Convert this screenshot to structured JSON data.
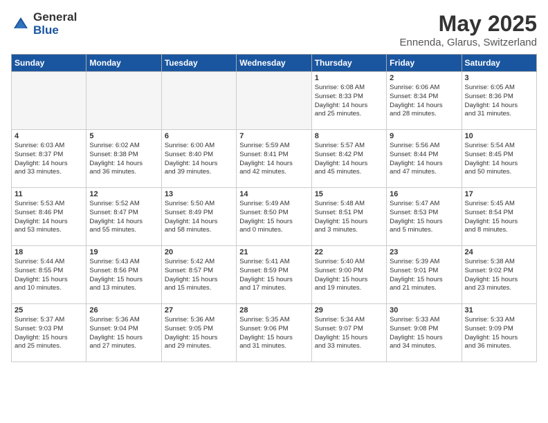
{
  "logo": {
    "general": "General",
    "blue": "Blue"
  },
  "title": "May 2025",
  "subtitle": "Ennenda, Glarus, Switzerland",
  "headers": [
    "Sunday",
    "Monday",
    "Tuesday",
    "Wednesday",
    "Thursday",
    "Friday",
    "Saturday"
  ],
  "weeks": [
    [
      {
        "day": "",
        "content": "",
        "empty": true
      },
      {
        "day": "",
        "content": "",
        "empty": true
      },
      {
        "day": "",
        "content": "",
        "empty": true
      },
      {
        "day": "",
        "content": "",
        "empty": true
      },
      {
        "day": "1",
        "content": "Sunrise: 6:08 AM\nSunset: 8:33 PM\nDaylight: 14 hours\nand 25 minutes."
      },
      {
        "day": "2",
        "content": "Sunrise: 6:06 AM\nSunset: 8:34 PM\nDaylight: 14 hours\nand 28 minutes."
      },
      {
        "day": "3",
        "content": "Sunrise: 6:05 AM\nSunset: 8:36 PM\nDaylight: 14 hours\nand 31 minutes."
      }
    ],
    [
      {
        "day": "4",
        "content": "Sunrise: 6:03 AM\nSunset: 8:37 PM\nDaylight: 14 hours\nand 33 minutes."
      },
      {
        "day": "5",
        "content": "Sunrise: 6:02 AM\nSunset: 8:38 PM\nDaylight: 14 hours\nand 36 minutes."
      },
      {
        "day": "6",
        "content": "Sunrise: 6:00 AM\nSunset: 8:40 PM\nDaylight: 14 hours\nand 39 minutes."
      },
      {
        "day": "7",
        "content": "Sunrise: 5:59 AM\nSunset: 8:41 PM\nDaylight: 14 hours\nand 42 minutes."
      },
      {
        "day": "8",
        "content": "Sunrise: 5:57 AM\nSunset: 8:42 PM\nDaylight: 14 hours\nand 45 minutes."
      },
      {
        "day": "9",
        "content": "Sunrise: 5:56 AM\nSunset: 8:44 PM\nDaylight: 14 hours\nand 47 minutes."
      },
      {
        "day": "10",
        "content": "Sunrise: 5:54 AM\nSunset: 8:45 PM\nDaylight: 14 hours\nand 50 minutes."
      }
    ],
    [
      {
        "day": "11",
        "content": "Sunrise: 5:53 AM\nSunset: 8:46 PM\nDaylight: 14 hours\nand 53 minutes."
      },
      {
        "day": "12",
        "content": "Sunrise: 5:52 AM\nSunset: 8:47 PM\nDaylight: 14 hours\nand 55 minutes."
      },
      {
        "day": "13",
        "content": "Sunrise: 5:50 AM\nSunset: 8:49 PM\nDaylight: 14 hours\nand 58 minutes."
      },
      {
        "day": "14",
        "content": "Sunrise: 5:49 AM\nSunset: 8:50 PM\nDaylight: 15 hours\nand 0 minutes."
      },
      {
        "day": "15",
        "content": "Sunrise: 5:48 AM\nSunset: 8:51 PM\nDaylight: 15 hours\nand 3 minutes."
      },
      {
        "day": "16",
        "content": "Sunrise: 5:47 AM\nSunset: 8:53 PM\nDaylight: 15 hours\nand 5 minutes."
      },
      {
        "day": "17",
        "content": "Sunrise: 5:45 AM\nSunset: 8:54 PM\nDaylight: 15 hours\nand 8 minutes."
      }
    ],
    [
      {
        "day": "18",
        "content": "Sunrise: 5:44 AM\nSunset: 8:55 PM\nDaylight: 15 hours\nand 10 minutes."
      },
      {
        "day": "19",
        "content": "Sunrise: 5:43 AM\nSunset: 8:56 PM\nDaylight: 15 hours\nand 13 minutes."
      },
      {
        "day": "20",
        "content": "Sunrise: 5:42 AM\nSunset: 8:57 PM\nDaylight: 15 hours\nand 15 minutes."
      },
      {
        "day": "21",
        "content": "Sunrise: 5:41 AM\nSunset: 8:59 PM\nDaylight: 15 hours\nand 17 minutes."
      },
      {
        "day": "22",
        "content": "Sunrise: 5:40 AM\nSunset: 9:00 PM\nDaylight: 15 hours\nand 19 minutes."
      },
      {
        "day": "23",
        "content": "Sunrise: 5:39 AM\nSunset: 9:01 PM\nDaylight: 15 hours\nand 21 minutes."
      },
      {
        "day": "24",
        "content": "Sunrise: 5:38 AM\nSunset: 9:02 PM\nDaylight: 15 hours\nand 23 minutes."
      }
    ],
    [
      {
        "day": "25",
        "content": "Sunrise: 5:37 AM\nSunset: 9:03 PM\nDaylight: 15 hours\nand 25 minutes."
      },
      {
        "day": "26",
        "content": "Sunrise: 5:36 AM\nSunset: 9:04 PM\nDaylight: 15 hours\nand 27 minutes."
      },
      {
        "day": "27",
        "content": "Sunrise: 5:36 AM\nSunset: 9:05 PM\nDaylight: 15 hours\nand 29 minutes."
      },
      {
        "day": "28",
        "content": "Sunrise: 5:35 AM\nSunset: 9:06 PM\nDaylight: 15 hours\nand 31 minutes."
      },
      {
        "day": "29",
        "content": "Sunrise: 5:34 AM\nSunset: 9:07 PM\nDaylight: 15 hours\nand 33 minutes."
      },
      {
        "day": "30",
        "content": "Sunrise: 5:33 AM\nSunset: 9:08 PM\nDaylight: 15 hours\nand 34 minutes."
      },
      {
        "day": "31",
        "content": "Sunrise: 5:33 AM\nSunset: 9:09 PM\nDaylight: 15 hours\nand 36 minutes."
      }
    ]
  ]
}
